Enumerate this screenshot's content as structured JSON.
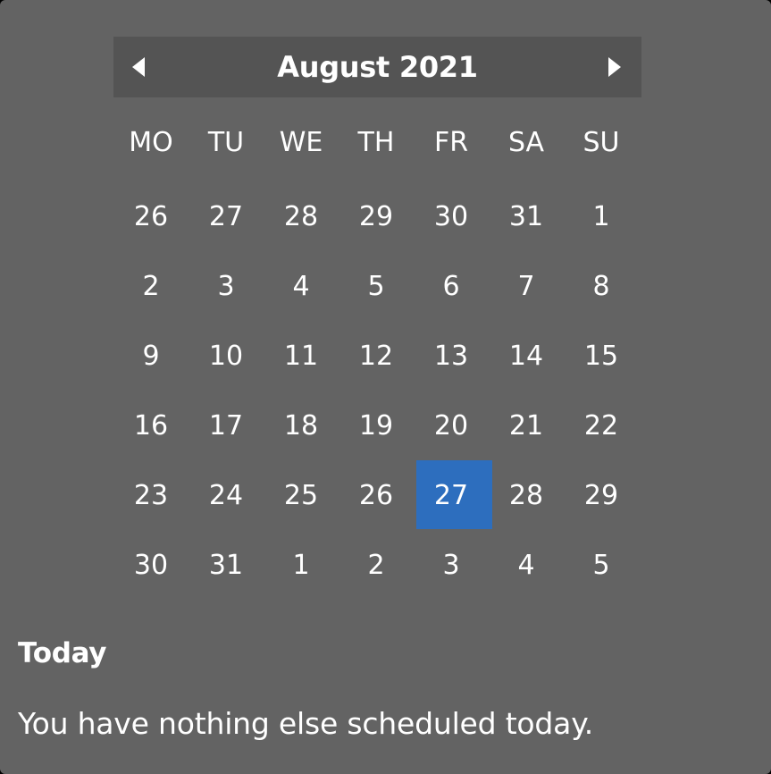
{
  "calendar": {
    "month_label": "August 2021",
    "prev_icon": "chevron-left-icon",
    "next_icon": "chevron-right-icon",
    "weekdays": [
      "MO",
      "TU",
      "WE",
      "TH",
      "FR",
      "SA",
      "SU"
    ],
    "days": [
      {
        "label": "26",
        "in_month": false
      },
      {
        "label": "27",
        "in_month": false
      },
      {
        "label": "28",
        "in_month": false
      },
      {
        "label": "29",
        "in_month": false
      },
      {
        "label": "30",
        "in_month": false
      },
      {
        "label": "31",
        "in_month": false
      },
      {
        "label": "1",
        "in_month": true
      },
      {
        "label": "2",
        "in_month": true
      },
      {
        "label": "3",
        "in_month": true
      },
      {
        "label": "4",
        "in_month": true
      },
      {
        "label": "5",
        "in_month": true
      },
      {
        "label": "6",
        "in_month": true
      },
      {
        "label": "7",
        "in_month": true
      },
      {
        "label": "8",
        "in_month": true
      },
      {
        "label": "9",
        "in_month": true
      },
      {
        "label": "10",
        "in_month": true
      },
      {
        "label": "11",
        "in_month": true
      },
      {
        "label": "12",
        "in_month": true
      },
      {
        "label": "13",
        "in_month": true
      },
      {
        "label": "14",
        "in_month": true
      },
      {
        "label": "15",
        "in_month": true
      },
      {
        "label": "16",
        "in_month": true
      },
      {
        "label": "17",
        "in_month": true
      },
      {
        "label": "18",
        "in_month": true
      },
      {
        "label": "19",
        "in_month": true
      },
      {
        "label": "20",
        "in_month": true
      },
      {
        "label": "21",
        "in_month": true
      },
      {
        "label": "22",
        "in_month": true
      },
      {
        "label": "23",
        "in_month": true
      },
      {
        "label": "24",
        "in_month": true
      },
      {
        "label": "25",
        "in_month": true
      },
      {
        "label": "26",
        "in_month": true
      },
      {
        "label": "27",
        "in_month": true,
        "selected": true
      },
      {
        "label": "28",
        "in_month": true
      },
      {
        "label": "29",
        "in_month": true
      },
      {
        "label": "30",
        "in_month": true
      },
      {
        "label": "31",
        "in_month": true
      },
      {
        "label": "1",
        "in_month": false
      },
      {
        "label": "2",
        "in_month": false
      },
      {
        "label": "3",
        "in_month": false
      },
      {
        "label": "4",
        "in_month": false
      },
      {
        "label": "5",
        "in_month": false
      }
    ]
  },
  "agenda": {
    "title": "Today",
    "message": "You have nothing else scheduled today."
  },
  "colors": {
    "panel_background": "#636363",
    "header_background": "#545454",
    "selected_day": "#2d6ebe",
    "text": "#ffffff"
  }
}
